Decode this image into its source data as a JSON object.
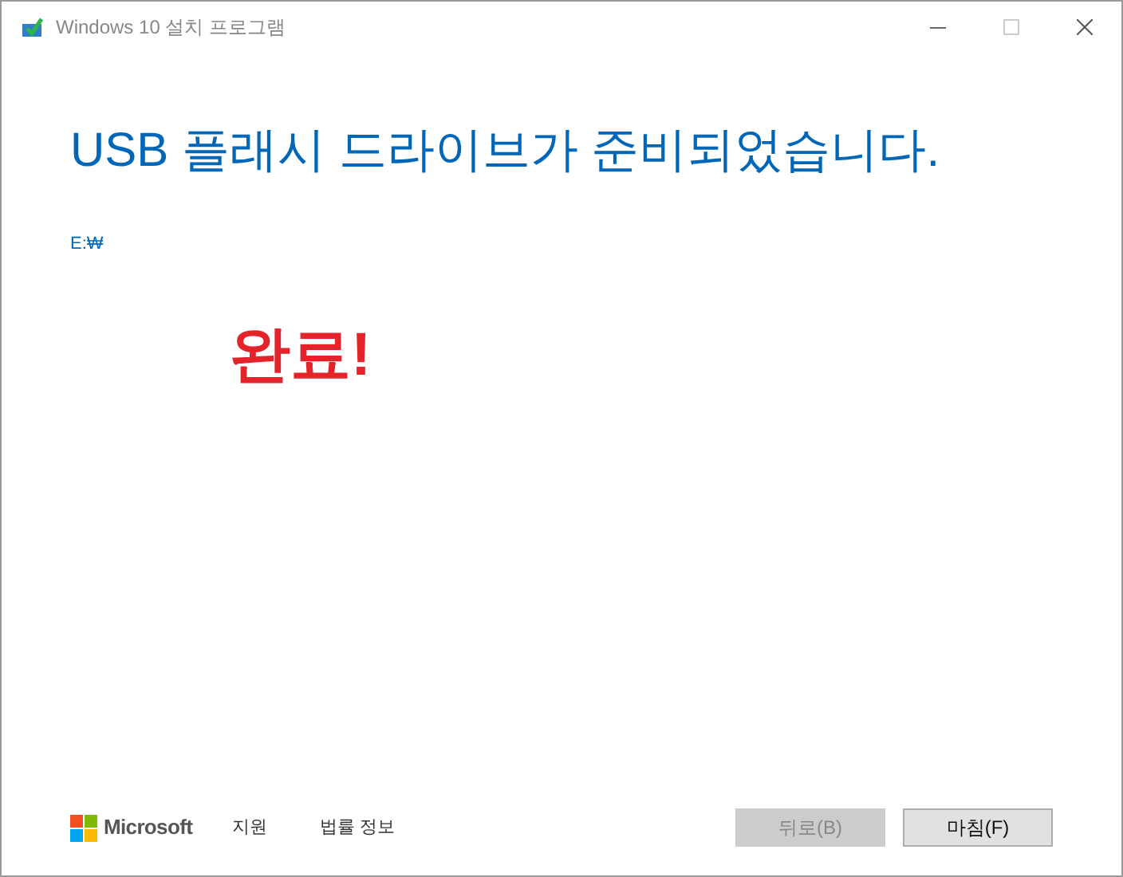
{
  "window": {
    "title": "Windows 10 설치 프로그램"
  },
  "heading": "USB 플래시 드라이브가 준비되었습니다.",
  "drive": "E:₩",
  "annotation": "완료!",
  "footer": {
    "brand": "Microsoft",
    "links": [
      "지원",
      "법률 정보"
    ]
  },
  "buttons": [
    {
      "label": "뒤로(B)",
      "disabled": true
    },
    {
      "label": "마침(F)",
      "disabled": false
    }
  ]
}
